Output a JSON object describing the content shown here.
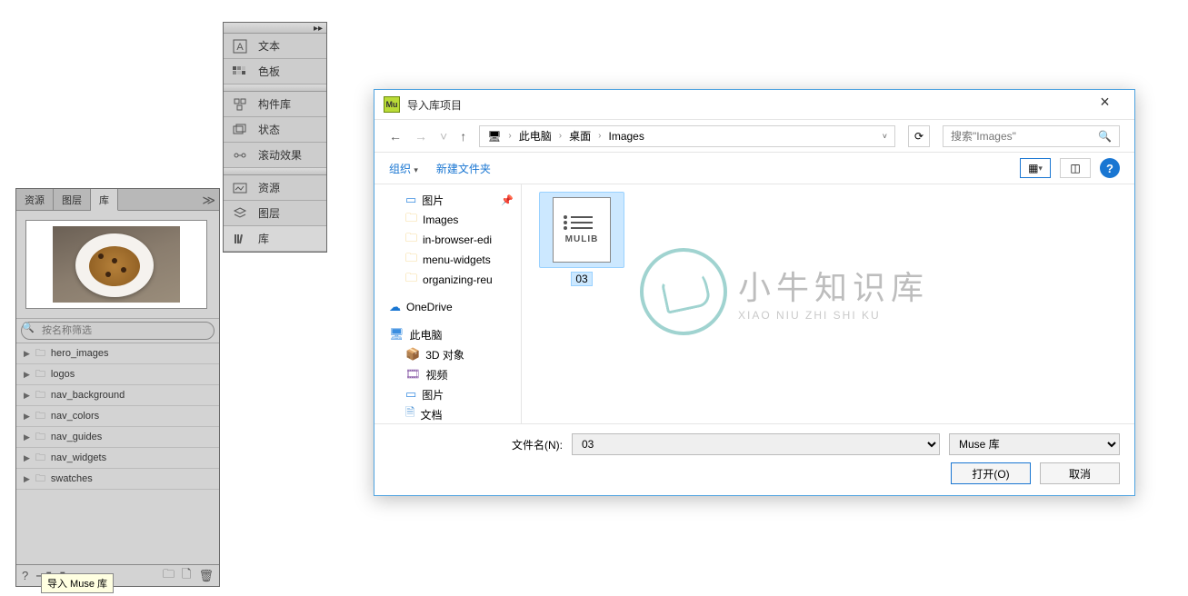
{
  "panels": {
    "text": "文本",
    "swatches": "色板",
    "widgets_lib": "构件库",
    "states": "状态",
    "scroll_effects": "滚动效果",
    "assets": "资源",
    "layers": "图层",
    "library": "库"
  },
  "lib_panel": {
    "tabs": [
      "资源",
      "图层",
      "库"
    ],
    "search_placeholder": "按名称筛选",
    "items": [
      "hero_images",
      "logos",
      "nav_background",
      "nav_colors",
      "nav_guides",
      "nav_widgets",
      "swatches"
    ]
  },
  "tooltip": "导入 Muse 库",
  "dialog": {
    "title": "导入库项目",
    "breadcrumb": [
      "此电脑",
      "桌面",
      "Images"
    ],
    "search_placeholder": "搜索\"Images\"",
    "organize": "组织",
    "new_folder": "新建文件夹",
    "tree": {
      "pictures": "图片",
      "images": "Images",
      "inbrowser": "in-browser-edi",
      "menu": "menu-widgets",
      "organizing": "organizing-reu",
      "onedrive": "OneDrive",
      "this_pc": "此电脑",
      "objects_3d": "3D 对象",
      "videos": "视频",
      "pictures2": "图片",
      "docs": "文档"
    },
    "file_label": "MULIB",
    "file_name": "03",
    "filename_label": "文件名(N):",
    "filename_value": "03",
    "filter": "Muse 库",
    "open": "打开(O)",
    "cancel": "取消"
  },
  "watermark": {
    "cn": "小牛知识库",
    "en": "XIAO NIU ZHI SHI KU"
  }
}
